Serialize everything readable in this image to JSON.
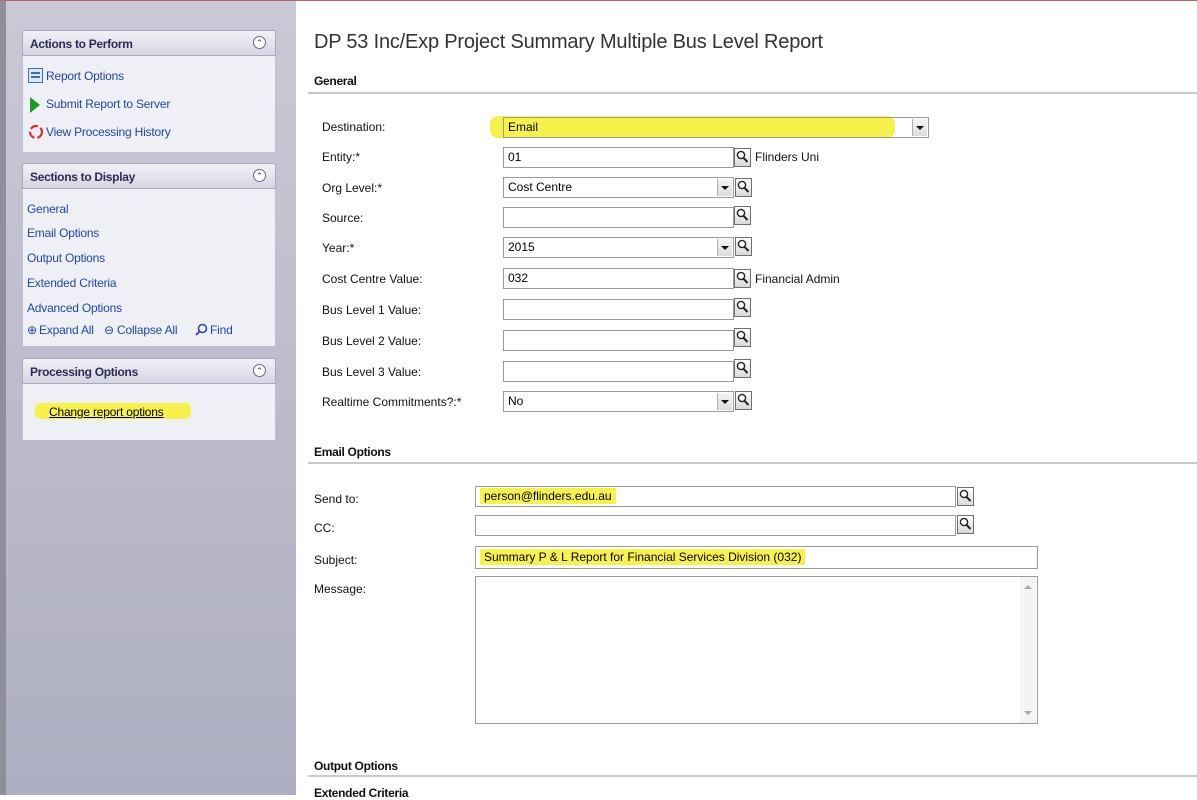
{
  "page": {
    "title": "DP 53 Inc/Exp  Project Summary Multiple Bus Level Report"
  },
  "left": {
    "actions": {
      "title": "Actions to Perform",
      "items": [
        {
          "label": "Report Options",
          "icon": "report-options-icon"
        },
        {
          "label": "Submit Report to Server",
          "icon": "play-icon"
        },
        {
          "label": "View Processing History",
          "icon": "history-icon"
        }
      ]
    },
    "sections": {
      "title": "Sections to Display",
      "items": [
        "General",
        "Email Options",
        "Output Options",
        "Extended Criteria",
        "Advanced Options"
      ],
      "expand_all": "Expand All",
      "collapse_all": "Collapse All",
      "find": "Find"
    },
    "processing": {
      "title": "Processing Options",
      "link": "Change report options"
    }
  },
  "general": {
    "title": "General",
    "destination": {
      "label": "Destination:",
      "value": "Email"
    },
    "entity": {
      "label": "Entity:*",
      "value": "01",
      "desc": "Flinders Uni"
    },
    "org_level": {
      "label": "Org Level:*",
      "value": "Cost Centre"
    },
    "source": {
      "label": "Source:",
      "value": ""
    },
    "year": {
      "label": "Year:*",
      "value": "2015"
    },
    "cost_centre": {
      "label": "Cost Centre Value:",
      "value": "032",
      "desc": "Financial Admin"
    },
    "bus1": {
      "label": "Bus Level 1 Value:",
      "value": ""
    },
    "bus2": {
      "label": "Bus Level 2 Value:",
      "value": ""
    },
    "bus3": {
      "label": "Bus Level 3 Value:",
      "value": ""
    },
    "realtime": {
      "label": "Realtime Commitments?:*",
      "value": "No"
    }
  },
  "email": {
    "title": "Email Options",
    "send_to": {
      "label": "Send to:",
      "value": "person@flinders.edu.au"
    },
    "cc": {
      "label": "CC:",
      "value": ""
    },
    "subject": {
      "label": "Subject:",
      "value": "Summary P & L Report for Financial Services Division (032)"
    },
    "message": {
      "label": "Message:",
      "value": ""
    }
  },
  "output": {
    "title": "Output Options"
  },
  "extended": {
    "title": "Extended Criteria"
  },
  "colors": {
    "highlight": "#f6f24a",
    "link": "#2246a8"
  }
}
